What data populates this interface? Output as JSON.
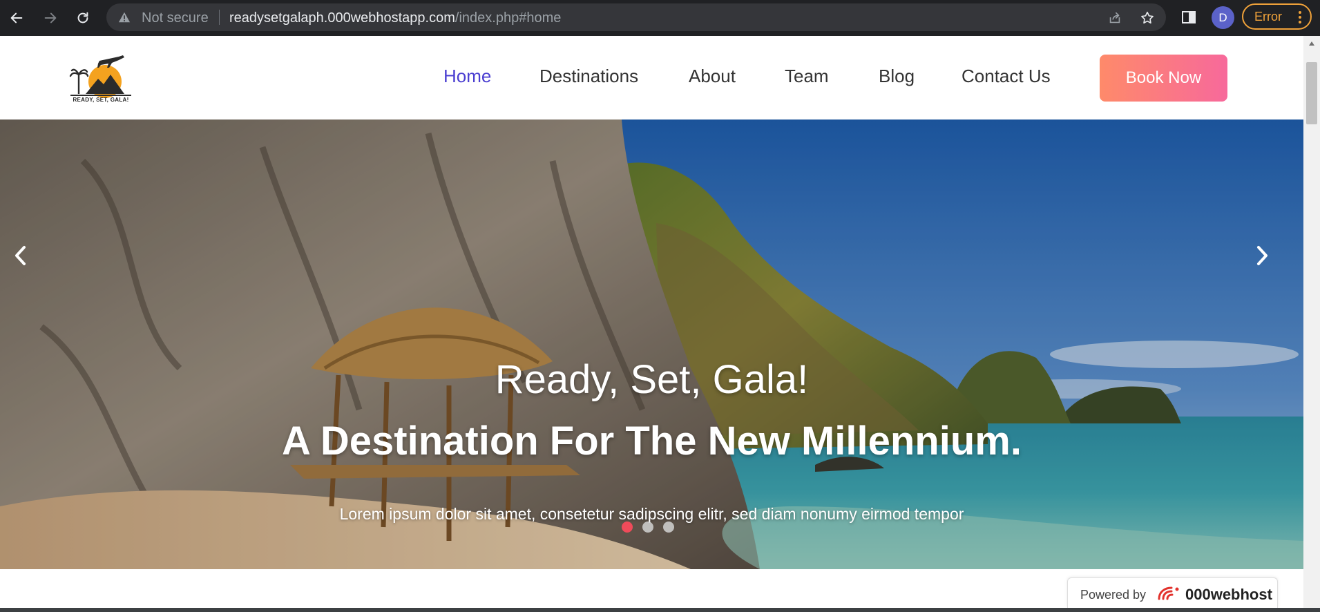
{
  "browser": {
    "security_label": "Not secure",
    "url_host": "readysetgalaph.000webhostapp.com",
    "url_path": "/index.php#home",
    "profile_initial": "D",
    "error_label": "Error"
  },
  "site": {
    "logo_text": "READY, SET, GALA!",
    "nav": [
      {
        "label": "Home",
        "active": true
      },
      {
        "label": "Destinations",
        "active": false
      },
      {
        "label": "About",
        "active": false
      },
      {
        "label": "Team",
        "active": false
      },
      {
        "label": "Blog",
        "active": false
      },
      {
        "label": "Contact Us",
        "active": false
      }
    ],
    "cta_label": "Book Now"
  },
  "hero": {
    "title": "Ready, Set, Gala!",
    "subtitle": "A Destination For The New Millennium.",
    "text": "Lorem ipsum dolor sit amet, consetetur sadipscing elitr, sed diam nonumy eirmod tempor",
    "slide_count": 3,
    "active_slide": 1
  },
  "footer_badge": {
    "prefix": "Powered by",
    "brand": "000webhost"
  },
  "colors": {
    "nav_active": "#4b3fd1",
    "cta_gradient_start": "#fe8a6a",
    "cta_gradient_end": "#f7699b",
    "indicator_active": "#ef4b5a",
    "error_accent": "#f0a23a"
  }
}
